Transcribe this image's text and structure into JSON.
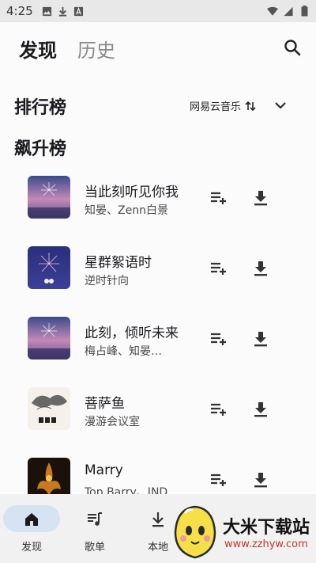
{
  "status": {
    "time": "4:25"
  },
  "header": {
    "tab_active": "发现",
    "tab_inactive": "历史"
  },
  "rank": {
    "title": "排行榜",
    "source": "网易云音乐"
  },
  "section": {
    "title": "飙升榜"
  },
  "songs": [
    {
      "title": "当此刻听见你我",
      "artist": "知晏、Zenn白景"
    },
    {
      "title": "星群絮语时",
      "artist": "逆时针向"
    },
    {
      "title": "此刻，倾听未来",
      "artist": "梅占峰、知晏…"
    },
    {
      "title": "菩萨鱼",
      "artist": "漫游会议室"
    },
    {
      "title": "Marry",
      "artist": "Top Barry、IND"
    }
  ],
  "nav": {
    "items": [
      {
        "label": "发现",
        "icon": "home-icon"
      },
      {
        "label": "歌单",
        "icon": "playlist-icon"
      },
      {
        "label": "本地",
        "icon": "download-icon"
      }
    ]
  },
  "watermark": {
    "text": "大米下载站",
    "url": "www.zzhyw.com"
  },
  "colors": {
    "accent_pill": "#d6e3f2",
    "nav_bg": "#f1f1f1",
    "status_bg": "#e8e8e8"
  }
}
